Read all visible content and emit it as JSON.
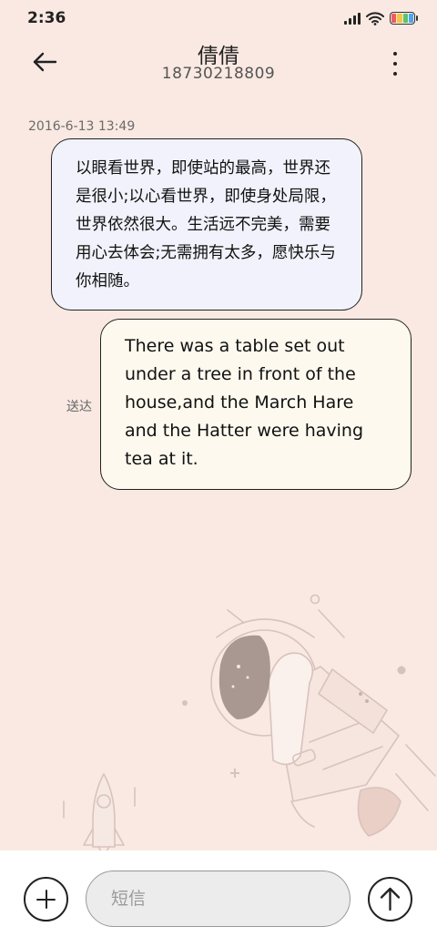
{
  "status_bar": {
    "time": "2:36",
    "icons": [
      "signal-icon",
      "wifi-icon",
      "battery-icon"
    ],
    "battery_colors": [
      "#f25b5b",
      "#f5c542",
      "#59c46a",
      "#4aa6f0"
    ]
  },
  "header": {
    "contact_name": "倩倩",
    "phone_number": "18730218809",
    "back_icon": "back-arrow-icon",
    "more_icon": "more-vertical-icon"
  },
  "conversation": {
    "timestamp": "2016-6-13 13:49",
    "incoming_message": "以眼看世界，即使站的最高，世界还是很小;以心看世界，即使身处局限，世界依然很大。生活远不完美，需要用心去体会;无需拥有太多，愿快乐与你相随。",
    "outgoing_message": "There was a table set out under a tree in front of the house,and the March Hare and the Hatter were having tea at it.",
    "delivery_status": "送达"
  },
  "composer": {
    "placeholder": "短信",
    "value": "",
    "add_icon": "plus-icon",
    "send_icon": "arrow-up-icon"
  },
  "colors": {
    "background": "#f9e9e2",
    "incoming_bubble": "#f1f2fb",
    "outgoing_bubble": "#fdf9ef",
    "input_bar": "#ffffff"
  }
}
